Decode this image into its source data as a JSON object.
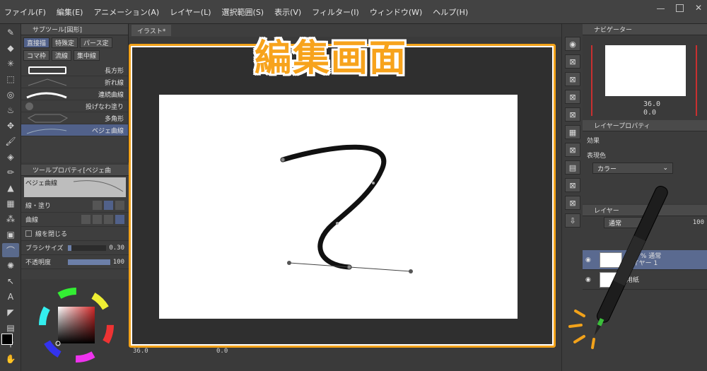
{
  "menu": [
    "ファイル(F)",
    "編集(E)",
    "アニメーション(A)",
    "レイヤー(L)",
    "選択範囲(S)",
    "表示(V)",
    "フィルター(I)",
    "ウィンドウ(W)",
    "ヘルプ(H)"
  ],
  "subtool": {
    "header": "サブツール[図形]",
    "tabs": [
      "直接描",
      "特殊定",
      "パース定",
      "コマ枠",
      "流線",
      "集中線"
    ],
    "active_tab": "直接描",
    "brushes": [
      "長方形",
      "折れ線",
      "連続曲線",
      "投げなわ塗り",
      "多角形",
      "ベジェ曲線"
    ],
    "selected_brush": "ベジェ曲線"
  },
  "toolprop": {
    "header": "ツールプロパティ[ベジェ曲",
    "preview_label": "ベジェ曲線",
    "line_fill_label": "線・塗り",
    "curve_label": "曲線",
    "close_label": "線を閉じる",
    "brush_size_label": "ブラシサイズ",
    "brush_size_value": "0.30",
    "opacity_label": "不透明度",
    "opacity_value": "100",
    "brush_size_fraction": 0.1,
    "opacity_fraction": 1.0
  },
  "canvas": {
    "tab_label": "イラスト*",
    "title": "編集画面",
    "zoom": "36.0",
    "coord": "0.0"
  },
  "navigator": {
    "header": "ナビゲーター",
    "zoom": "36.0",
    "rotation": "0.0"
  },
  "layerprop": {
    "header": "レイヤープロパティ",
    "effect_label": "効果",
    "express_label": "表現色",
    "color_mode": "カラー"
  },
  "layers": {
    "header": "レイヤー",
    "blend_mode": "通常",
    "opacity": "100",
    "items": [
      {
        "name": "100 % 通常\nレイヤー 1"
      },
      {
        "name": "用紙"
      }
    ]
  },
  "color": {
    "fg": "#000000",
    "bg": "#ffffff",
    "accent": "#f2a21a",
    "values": [
      "0",
      "0",
      "0"
    ]
  }
}
